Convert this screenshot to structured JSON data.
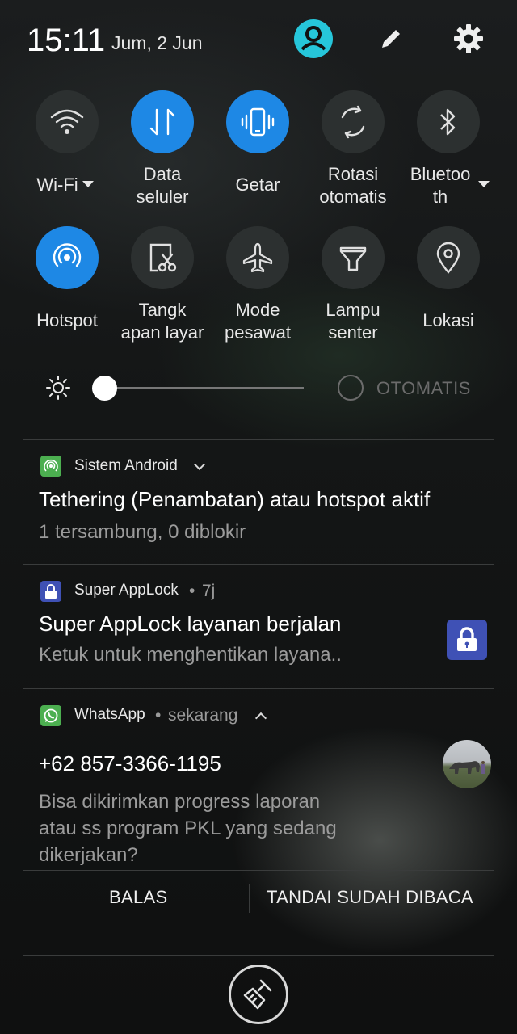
{
  "status_bar": {
    "time": "15:11",
    "date": "Jum, 2 Jun",
    "icons": [
      "user-profile-icon",
      "edit-pencil-icon",
      "settings-gear-icon"
    ],
    "accent_color": "#1e88e5"
  },
  "quick_tiles": {
    "row1": [
      {
        "name": "wifi",
        "label": "Wi-Fi",
        "icon": "wifi-icon",
        "active": false,
        "has_dropdown": true
      },
      {
        "name": "data",
        "label": "Data\nseluler",
        "icon": "data-arrows-icon",
        "active": true,
        "has_dropdown": false
      },
      {
        "name": "vibrate",
        "label": "Getar",
        "icon": "vibrate-icon",
        "active": true,
        "has_dropdown": false
      },
      {
        "name": "rotate",
        "label": "Rotasi\notomatis",
        "icon": "rotate-icon",
        "active": false,
        "has_dropdown": false
      },
      {
        "name": "bluetooth",
        "label": "Bluetoo\nth",
        "icon": "bluetooth-icon",
        "active": false,
        "has_dropdown": true
      }
    ],
    "row2": [
      {
        "name": "hotspot",
        "label": "Hotspot",
        "icon": "hotspot-icon",
        "active": true
      },
      {
        "name": "screenshot",
        "label": "Tangk\napan layar",
        "icon": "screenshot-icon",
        "active": false
      },
      {
        "name": "airplane",
        "label": "Mode\npesawat",
        "icon": "airplane-icon",
        "active": false
      },
      {
        "name": "flashlight",
        "label": "Lampu\nsenter",
        "icon": "flashlight-icon",
        "active": false
      },
      {
        "name": "location",
        "label": "Lokasi",
        "icon": "location-icon",
        "active": false
      }
    ]
  },
  "brightness": {
    "level": 0.0,
    "auto_label": "OTOMATIS",
    "auto_enabled": false
  },
  "notifications": [
    {
      "app": "Sistem Android",
      "time": "",
      "icon": "hotspot-app-icon",
      "icon_color": "#4caf50",
      "title": "Tethering (Penambatan) atau hotspot aktif",
      "text": "1 tersambung, 0 diblokir"
    },
    {
      "app": "Super AppLock",
      "time": "7j",
      "icon": "lock-app-icon",
      "icon_color": "#3f51b5",
      "title": "Super AppLock layanan berjalan",
      "text": "Ketuk untuk menghentikan layana.."
    },
    {
      "app": "WhatsApp",
      "time": "sekarang",
      "icon": "whatsapp-icon",
      "icon_color": "#4caf50",
      "title": "+62 857-3366-1195",
      "text_lines": [
        "Bisa dikirimkan progress laporan",
        "atau ss program PKL yang sedang",
        "dikerjakan?"
      ],
      "actions": {
        "reply": "BALAS",
        "mark_read": "TANDAI SUDAH DIBACA"
      }
    }
  ],
  "clear_all_icon": "clear-all-broom-icon"
}
